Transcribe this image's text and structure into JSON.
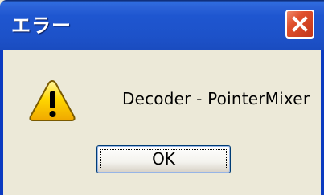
{
  "dialog": {
    "title": "エラー",
    "message": "Decoder - PointerMixer",
    "ok_label": "OK",
    "icon": "warning-icon",
    "close_icon": "close-icon"
  },
  "colors": {
    "titlebar": "#1d52c9",
    "close_button": "#e0502c",
    "dialog_background": "#ece9d8",
    "warning_fill": "#ffd700"
  }
}
